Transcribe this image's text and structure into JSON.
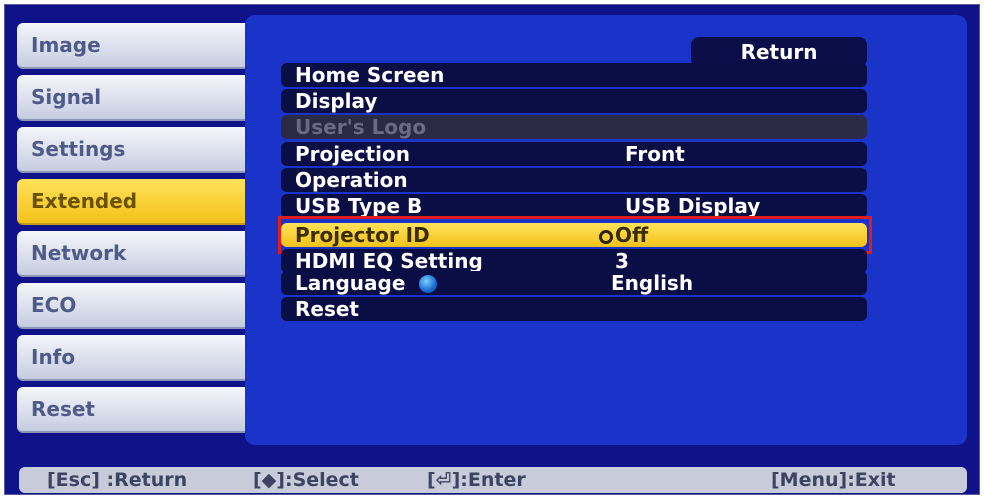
{
  "tabs": [
    {
      "label": "Image",
      "active": false
    },
    {
      "label": "Signal",
      "active": false
    },
    {
      "label": "Settings",
      "active": false
    },
    {
      "label": "Extended",
      "active": true
    },
    {
      "label": "Network",
      "active": false
    },
    {
      "label": "ECO",
      "active": false
    },
    {
      "label": "Info",
      "active": false
    },
    {
      "label": "Reset",
      "active": false
    }
  ],
  "panel": {
    "return_label": "Return",
    "rows": [
      {
        "label": "Home Screen",
        "value": ""
      },
      {
        "label": "Display",
        "value": ""
      },
      {
        "label": "User's Logo",
        "value": "",
        "disabled": true
      },
      {
        "label": "Projection",
        "value": "Front"
      },
      {
        "label": "Operation",
        "value": ""
      },
      {
        "label": "USB Type B",
        "value": "USB Display"
      },
      {
        "label": "Projector ID",
        "value": "Off",
        "selected": true
      },
      {
        "label": "HDMI EQ Setting",
        "value": "3"
      },
      {
        "label": "Language",
        "value": "English",
        "icon": "globe-icon"
      },
      {
        "label": "Reset",
        "value": ""
      }
    ]
  },
  "footer": {
    "return_hint": "[Esc] :Return",
    "select_hint": "[◆]:Select",
    "enter_hint": "[⏎]:Enter",
    "exit_hint": "[Menu]:Exit"
  },
  "colors": {
    "background": "#10128a",
    "panel": "#1a33c8",
    "highlight": "#f2c21a",
    "selection_outline": "#e11a1a"
  }
}
